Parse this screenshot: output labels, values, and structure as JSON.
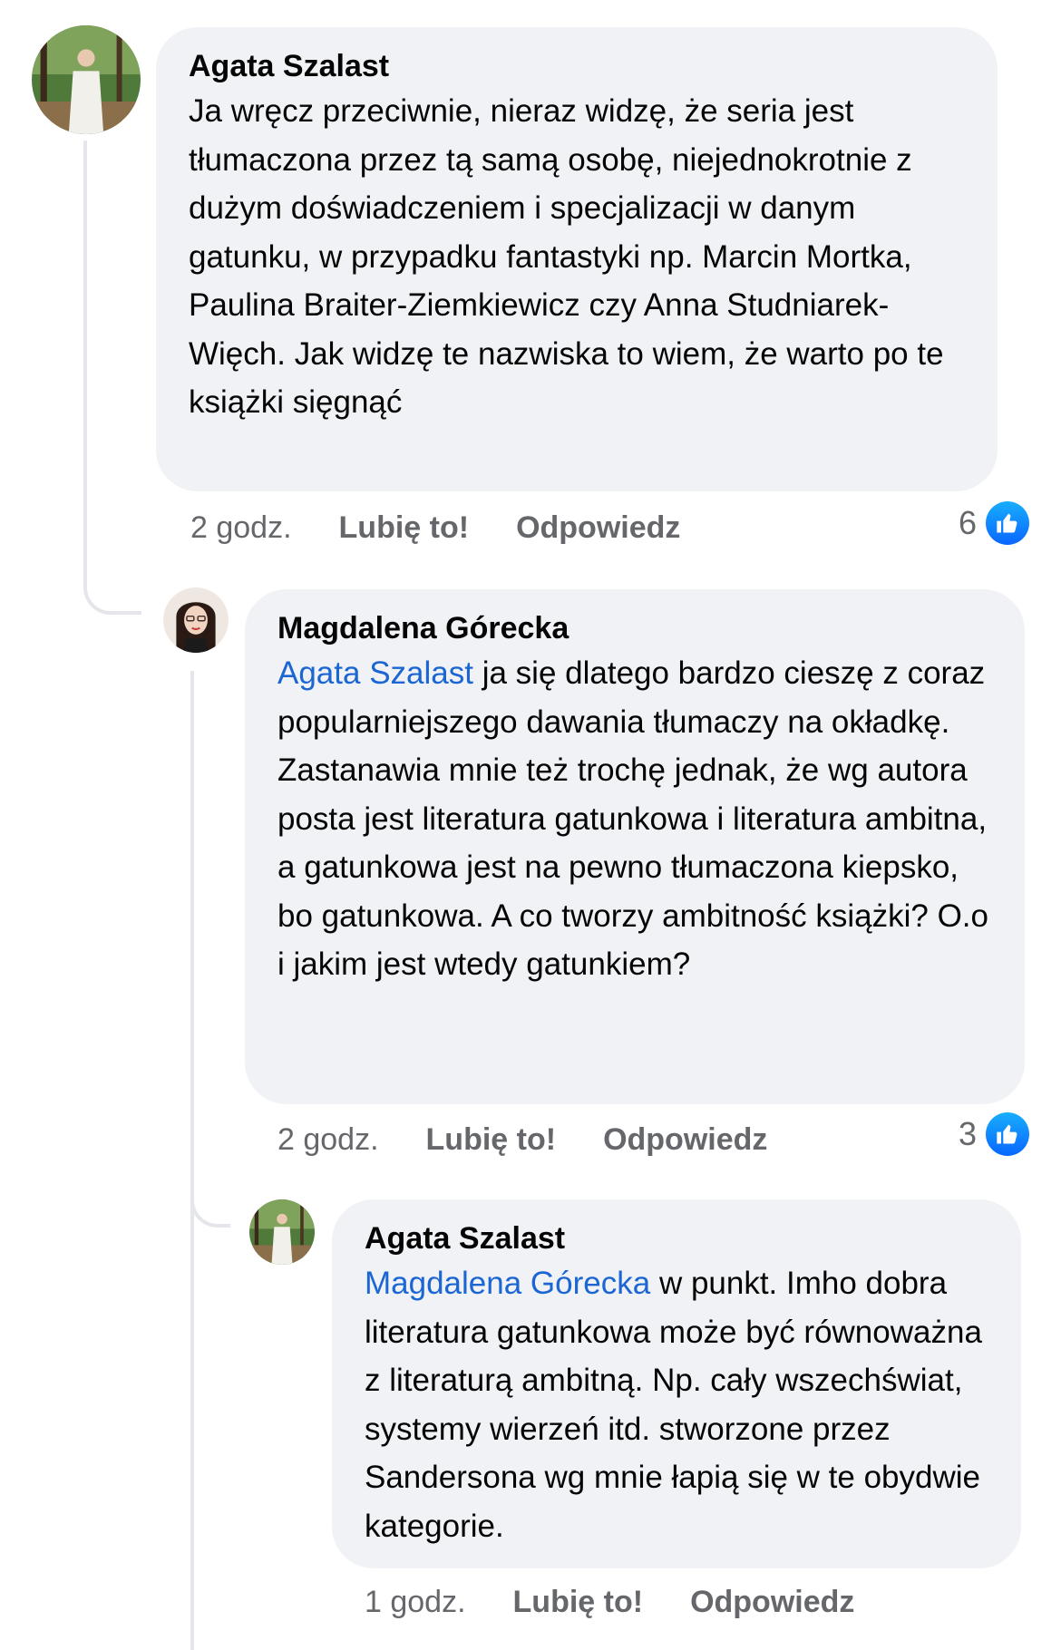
{
  "comments": [
    {
      "author": "Agata Szalast",
      "mention": "",
      "text": "Ja wręcz przeciwnie, nieraz widzę, że seria jest tłumaczona przez tą samą osobę, niejednokrotnie z dużym doświadczeniem i specjalizacji w danym gatunku, w przypadku fantastyki np. Marcin Mortka, Paulina Braiter-Ziemkiewicz czy Anna Studniarek-Więch. Jak widzę te nazwiska to wiem, że warto po te książki sięgnąć",
      "time": "2 godz.",
      "like_label": "Lubię to!",
      "reply_label": "Odpowiedz",
      "reaction_count": "6",
      "reaction_icon": "like-icon"
    },
    {
      "author": "Magdalena Górecka",
      "mention": "Agata Szalast",
      "text": "ja się dlatego bardzo cieszę z coraz popularniejszego dawania tłumaczy na okładkę. Zastanawia mnie też trochę jednak, że wg autora posta jest literatura gatunkowa i literatura ambitna, a gatunkowa jest na pewno tłumaczona kiepsko, bo gatunkowa. A co tworzy ambitność książki? O.o i jakim jest wtedy gatunkiem?",
      "time": "2 godz.",
      "like_label": "Lubię to!",
      "reply_label": "Odpowiedz",
      "reaction_count": "3",
      "reaction_icon": "like-icon"
    },
    {
      "author": "Agata Szalast",
      "mention": "Magdalena Górecka",
      "text": "w punkt. Imho dobra literatura gatunkowa może być równoważna z literaturą ambitną. Np. cały wszechświat, systemy wierzeń itd. stworzone przez Sandersona wg mnie łapią się w te obydwie kategorie.",
      "time": "1 godz.",
      "like_label": "Lubię to!",
      "reply_label": "Odpowiedz"
    }
  ],
  "colors": {
    "bubble": "#f0f2f5",
    "mention": "#1b66d2",
    "meta": "#65676b",
    "like_badge": "#0866ff"
  }
}
